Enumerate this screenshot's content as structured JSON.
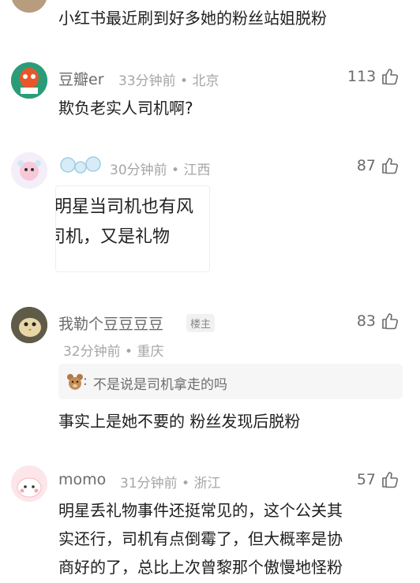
{
  "top_comment": {
    "text": "小红书最近刷到好多她的粉丝站姐脱粉"
  },
  "comments": [
    {
      "username": "豆瓣er",
      "time": "33分钟前",
      "location": "北京",
      "likes": "113",
      "text": "欺负老实人司机啊?"
    },
    {
      "username": "",
      "time": "30分钟前",
      "location": "江西",
      "likes": "87",
      "image_lines": [
        "明星当司机也有风",
        "司机，又是礼物"
      ]
    },
    {
      "username": "我勒个豆豆豆豆",
      "badge": "楼主",
      "time": "32分钟前",
      "location": "重庆",
      "likes": "83",
      "quote": "不是说是司机拿走的吗",
      "text": "事实上是她不要的 粉丝发现后脱粉"
    },
    {
      "username": "momo",
      "time": "31分钟前",
      "location": "浙江",
      "likes": "57",
      "lines": [
        "明星丢礼物事件还挺常见的，这个公关其",
        "实还行，司机有点倒霉了，但大概率是协",
        "商好的了，总比上次曾黎那个傲慢地怪粉"
      ]
    }
  ],
  "separator": "•",
  "colors": {
    "text": "#1e1e1e",
    "username": "#6b6b6b",
    "meta": "#a6a6a6",
    "quote_bg": "#f6f6f6"
  },
  "icons": [
    "thumbs-up-icon",
    "bear-emoji-icon",
    "bubbles-icon"
  ]
}
